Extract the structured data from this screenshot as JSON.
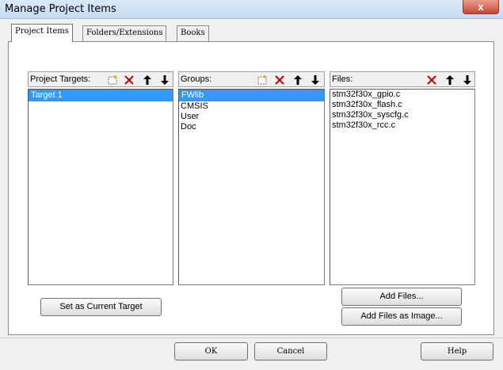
{
  "window": {
    "title": "Manage Project Items",
    "close_glyph": "x"
  },
  "tabs": [
    {
      "label": "Project Items",
      "active": true
    },
    {
      "label": "Folders/Extensions",
      "active": false
    },
    {
      "label": "Books",
      "active": false
    }
  ],
  "targets": {
    "label": "Project Targets:",
    "items": [
      "Target 1"
    ],
    "selected": 0,
    "tools": [
      "new-icon",
      "delete-icon",
      "move-up-icon",
      "move-down-icon"
    ]
  },
  "groups": {
    "label": "Groups:",
    "items": [
      "FWlib",
      "CMSIS",
      "User",
      "Doc"
    ],
    "selected": 0,
    "tools": [
      "new-icon",
      "delete-icon",
      "move-up-icon",
      "move-down-icon"
    ]
  },
  "files": {
    "label": "Files:",
    "items": [
      "stm32f30x_gpio.c",
      "stm32f30x_flash.c",
      "stm32f30x_syscfg.c",
      "stm32f30x_rcc.c"
    ],
    "tools": [
      "delete-icon",
      "move-up-icon",
      "move-down-icon"
    ]
  },
  "buttons": {
    "set_current_target": "Set as Current Target",
    "add_files": "Add Files...",
    "add_files_as_image": "Add Files as Image...",
    "ok": "OK",
    "cancel": "Cancel",
    "help": "Help"
  },
  "colors": {
    "selection": "#3399ff",
    "delete_icon": "#c00000",
    "dialog_bg": "#f0f0f0"
  }
}
